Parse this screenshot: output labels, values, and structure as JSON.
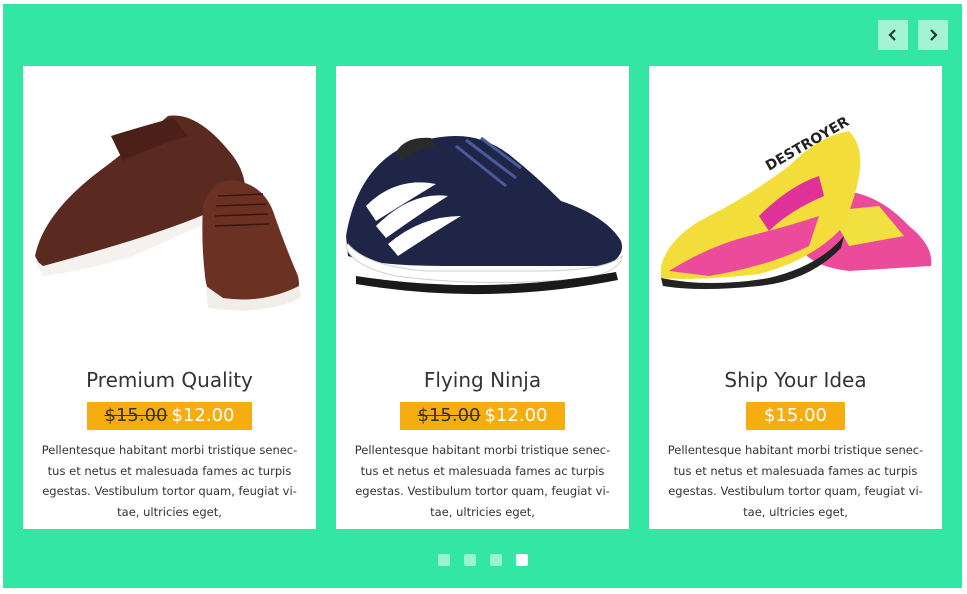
{
  "slider": {
    "prev_icon": "chevron-left-icon",
    "next_icon": "chevron-right-icon",
    "background_color": "#34e6a3",
    "price_color": "#f5ad0f"
  },
  "products": [
    {
      "title": "Premium Quality",
      "old_price": "$15.00",
      "price": "$12.00",
      "description": "Pellentesque habitant morbi tristique senec-tus et netus et malesuada fames ac turpis egestas. Vestibulum tortor quam, feugiat vi-tae, ultricies eget,"
    },
    {
      "title": "Flying Ninja",
      "old_price": "$15.00",
      "price": "$12.00",
      "description": "Pellentesque habitant morbi tristique senec-tus et netus et malesuada fames ac turpis egestas. Vestibulum tortor quam, feugiat vi-tae, ultricies eget,"
    },
    {
      "title": "Ship Your Idea",
      "old_price": "",
      "price": "$15.00",
      "description": "Pellentesque habitant morbi tristique senec-tus et netus et malesuada fames ac turpis egestas. Vestibulum tortor quam, feugiat vi-tae, ultricies eget,"
    }
  ],
  "pagination": {
    "dots": 4,
    "active_index": 3
  }
}
